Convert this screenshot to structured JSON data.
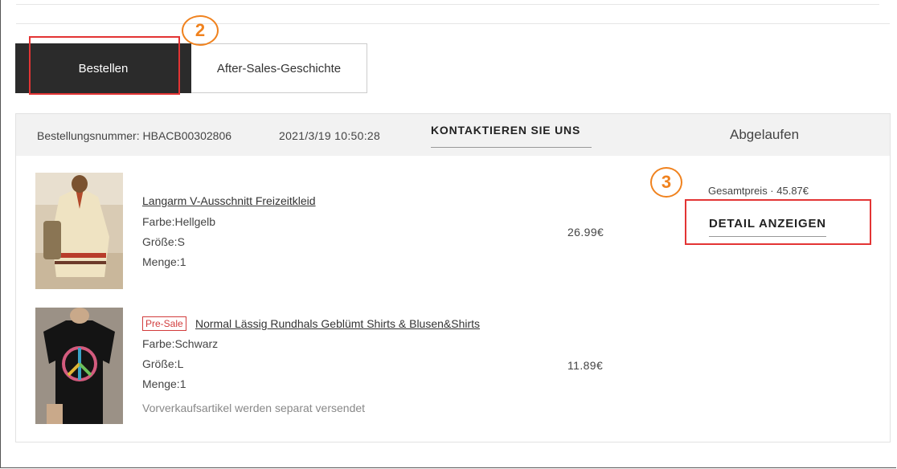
{
  "tabs": [
    {
      "label": "Bestellen",
      "active": true
    },
    {
      "label": "After-Sales-Geschichte",
      "active": false
    }
  ],
  "annotations": {
    "step2": "2",
    "step3": "3",
    "color_box": "#e33434",
    "color_circle": "#f0821e"
  },
  "order": {
    "number_label": "Bestellungsnummer: HBACB00302806",
    "date": "2021/3/19 10:50:28",
    "contact_label": "KONTAKTIEREN SIE UNS",
    "status": "Abgelaufen",
    "total_label": "Gesamtpreis · 45.87€",
    "detail_label": "DETAIL ANZEIGEN",
    "items": [
      {
        "name": "Langarm V-Ausschnitt Freizeitkleid",
        "color": "Farbe:Hellgelb",
        "size": "Größe:S",
        "qty": "Menge:1",
        "price": "26.99€",
        "image": "dress-photo"
      },
      {
        "badge": "Pre-Sale",
        "name": "Normal Lässig Rundhals Geblümt Shirts & Blusen&Shirts",
        "color": "Farbe:Schwarz",
        "size": "Größe:L",
        "qty": "Menge:1",
        "price": "11.89€",
        "note": "Vorverkaufsartikel werden separat versendet",
        "image": "tshirt-photo"
      }
    ]
  }
}
